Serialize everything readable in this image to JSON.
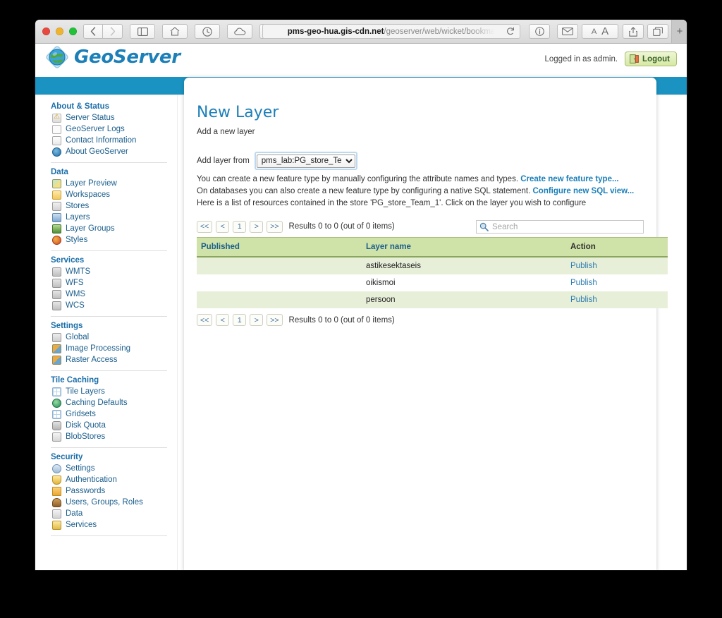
{
  "browser": {
    "url_host": "pms-geo-hua.gis-cdn.net",
    "url_path": "/geoserver/web/wicket/bookma",
    "back_label": "‹",
    "forward_label": "›",
    "reload_label": "⟳",
    "new_tab_label": "+",
    "text_small_label": "A",
    "text_large_label": "A"
  },
  "header": {
    "brand": "GeoServer",
    "login_text": "Logged in as admin.",
    "logout_label": "Logout"
  },
  "sidebar": {
    "sections": [
      {
        "title": "About & Status",
        "items": [
          {
            "label": "Server Status",
            "icon": "warning-icon"
          },
          {
            "label": "GeoServer Logs",
            "icon": "document-icon"
          },
          {
            "label": "Contact Information",
            "icon": "contact-card-icon"
          },
          {
            "label": "About GeoServer",
            "icon": "globe-info-icon"
          }
        ]
      },
      {
        "title": "Data",
        "items": [
          {
            "label": "Layer Preview",
            "icon": "map-preview-icon"
          },
          {
            "label": "Workspaces",
            "icon": "folder-icon"
          },
          {
            "label": "Stores",
            "icon": "database-icon"
          },
          {
            "label": "Layers",
            "icon": "layers-icon"
          },
          {
            "label": "Layer Groups",
            "icon": "layer-group-icon"
          },
          {
            "label": "Styles",
            "icon": "palette-icon"
          }
        ]
      },
      {
        "title": "Services",
        "items": [
          {
            "label": "WMTS",
            "icon": "service-icon"
          },
          {
            "label": "WFS",
            "icon": "service-icon"
          },
          {
            "label": "WMS",
            "icon": "service-icon"
          },
          {
            "label": "WCS",
            "icon": "service-icon"
          }
        ]
      },
      {
        "title": "Settings",
        "items": [
          {
            "label": "Global",
            "icon": "gear-icon"
          },
          {
            "label": "Image Processing",
            "icon": "image-icon"
          },
          {
            "label": "Raster Access",
            "icon": "raster-icon"
          }
        ]
      },
      {
        "title": "Tile Caching",
        "items": [
          {
            "label": "Tile Layers",
            "icon": "tile-grid-icon"
          },
          {
            "label": "Caching Defaults",
            "icon": "cache-globe-icon"
          },
          {
            "label": "Gridsets",
            "icon": "grid-icon"
          },
          {
            "label": "Disk Quota",
            "icon": "disk-icon"
          },
          {
            "label": "BlobStores",
            "icon": "blobstore-icon"
          }
        ]
      },
      {
        "title": "Security",
        "items": [
          {
            "label": "Settings",
            "icon": "wrench-icon"
          },
          {
            "label": "Authentication",
            "icon": "shield-icon"
          },
          {
            "label": "Passwords",
            "icon": "lock-icon"
          },
          {
            "label": "Users, Groups, Roles",
            "icon": "users-icon"
          },
          {
            "label": "Data",
            "icon": "data-security-icon"
          },
          {
            "label": "Services",
            "icon": "services-security-icon"
          }
        ]
      }
    ]
  },
  "main": {
    "title": "New Layer",
    "subtitle": "Add a new layer",
    "store_label": "Add layer from",
    "store_selected": "pms_lab:PG_store_Tea...",
    "store_options": [
      "pms_lab:PG_store_Tea..."
    ],
    "info_line_1_text": "You can create a new feature type by manually configuring the attribute names and types.",
    "info_line_1_link": "Create new feature type...",
    "info_line_2_text": "On databases you can also create a new feature type by configuring a native SQL statement.",
    "info_line_2_link": "Configure new SQL view...",
    "info_line_3": "Here is a list of resources contained in the store 'PG_store_Team_1'. Click on the layer you wish to configure",
    "pager": {
      "first_label": "<<",
      "prev_label": "<",
      "page_label": "1",
      "next_label": ">",
      "last_label": ">>",
      "results_text": "Results 0 to 0 (out of 0 items)"
    },
    "search": {
      "placeholder": "Search",
      "value": ""
    },
    "table": {
      "columns": [
        "Published",
        "Layer name",
        "Action"
      ],
      "rows": [
        {
          "published": "",
          "layer_name": "astikesektaseis",
          "action": "Publish"
        },
        {
          "published": "",
          "layer_name": "oikismoi",
          "action": "Publish"
        },
        {
          "published": "",
          "layer_name": "persoon",
          "action": "Publish"
        }
      ]
    }
  },
  "colors": {
    "brand_blue": "#1b7fb8",
    "header_bar": "#1b93c2",
    "table_header_green": "#cfe2a8",
    "row_alt_green": "#e8efd9",
    "link_blue": "#2b7cb0"
  }
}
